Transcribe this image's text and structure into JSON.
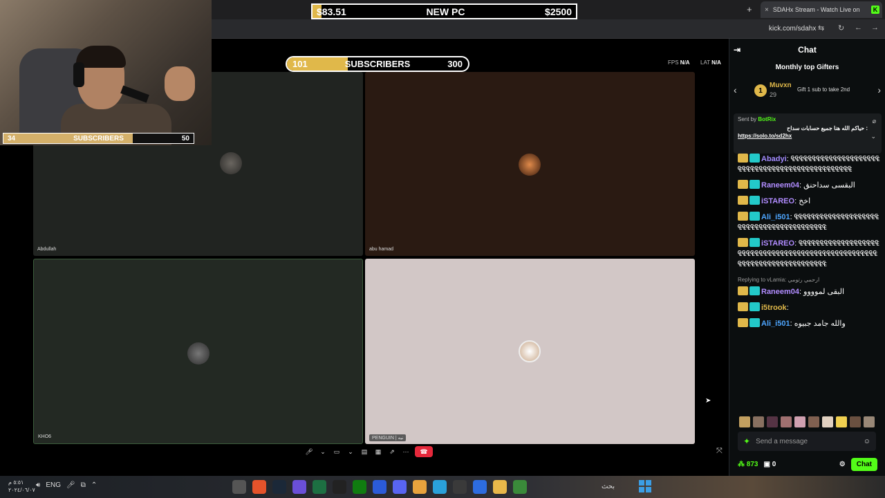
{
  "browser": {
    "tab_title": "SDAHx Stream - Watch Live on",
    "tab_close": "×",
    "new_tab": "+",
    "favicon_letter": "K",
    "url": "kick.com/sdahx"
  },
  "goal": {
    "left": "$83.51",
    "center": "NEW PC",
    "right": "$2500",
    "progress": 0.033
  },
  "webcam_sub": {
    "current": "34",
    "label": "SUBSCRIBERS",
    "target": "50",
    "progress": 0.68
  },
  "call": {
    "sub_goal": {
      "current": "101",
      "label": "SUBSCRIBERS",
      "target": "300",
      "progress": 0.337
    },
    "fps_label": "FPS",
    "fps_value": "N/A",
    "lat_label": "LAT",
    "lat_value": "N/A",
    "tiles": [
      {
        "name": "Abdullah"
      },
      {
        "name": "abu hamad"
      },
      {
        "name": "KHO6"
      },
      {
        "name": "PENGUIN | نيه"
      }
    ]
  },
  "chat": {
    "title": "Chat",
    "gifters_title": "Monthly top Gifters",
    "top_gifter": {
      "rank": "1",
      "name": "Muvxn",
      "count": "29"
    },
    "gift_cta": "Gift 1 sub to take 2nd",
    "pinned": {
      "sent_by_label": "Sent by",
      "sent_by_user": "BotRix",
      "message": "حياكم الله هنا جميع حسابات سداح :",
      "link": "https://solo.to/sd2hx"
    },
    "messages": [
      {
        "user": "Abadyi",
        "color": "#a38bff",
        "text": "₠₠₠₠₠₠₠₠₠₠₠₠₠₠₠₠₠₠₠₠₠₠₠₠₠₠₠₠₠₠₠₠₠₠₠₠₠₠₠₠₠₠₠₠₠₠₠₠"
      },
      {
        "user": "Raneem04",
        "color": "#b18cff",
        "text": "البقسى سداحنق"
      },
      {
        "user": "iSTAREO",
        "color": "#b18cff",
        "text": "اخخ"
      },
      {
        "user": "Ali_i501",
        "color": "#4ea6ff",
        "text": "₠₠₠₠₠₠₠₠₠₠₠₠₠₠₠₠₠₠₠₠₠₠₠₠₠₠₠₠₠₠₠₠₠₠₠₠₠₠₠₠₠"
      },
      {
        "user": "iSTAREO",
        "color": "#b18cff",
        "text": "₠₠₠₠₠₠₠₠₠₠₠₠₠₠₠₠₠₠₠₠₠₠₠₠₠₠₠₠₠₠₠₠₠₠₠₠₠₠₠₠₠₠₠₠₠₠₠₠₠₠₠₠₠₠₠₠₠₠₠₠₠₠₠₠₠₠₠₠₠₠₠₠₠"
      },
      {
        "reply": "Replying to vLamia: ارحمي رتومي",
        "user": "Raneem04",
        "color": "#b18cff",
        "text": "البقى لموووو"
      },
      {
        "user": "i5trook",
        "color": "#e0b84a",
        "text": ""
      },
      {
        "user": "Ali_i501",
        "color": "#4ea6ff",
        "text": "والله جامد جبيوه"
      }
    ],
    "input_placeholder": "Send a message",
    "points": "873",
    "gifts": "0",
    "chat_button": "Chat"
  },
  "taskbar": {
    "time": "٥:٥١ م",
    "date": "٢٠٢٤/٠٦/٠٧",
    "lang": "ENG",
    "search": "بحث"
  }
}
